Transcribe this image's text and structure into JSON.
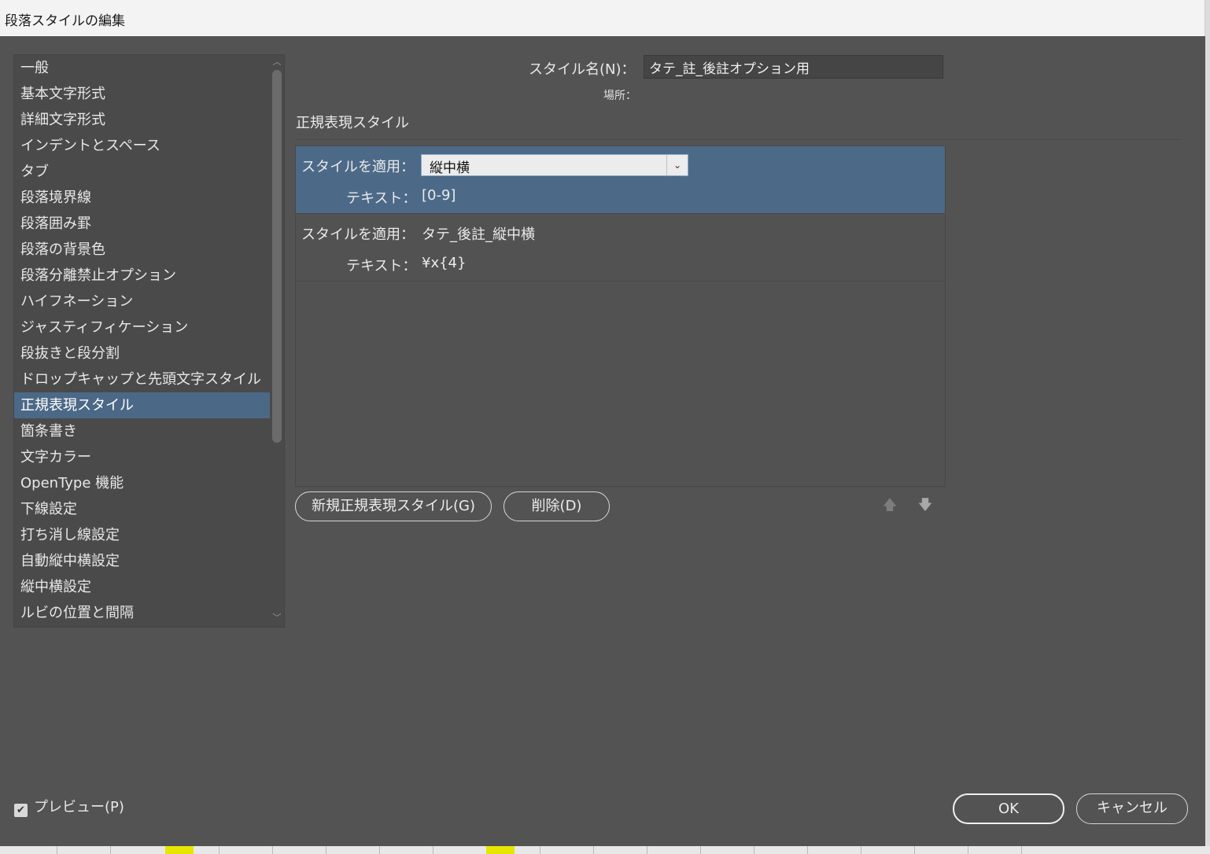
{
  "window": {
    "title": "段落スタイルの編集"
  },
  "sidebar": {
    "items": [
      {
        "label": "一般"
      },
      {
        "label": "基本文字形式"
      },
      {
        "label": "詳細文字形式"
      },
      {
        "label": "インデントとスペース"
      },
      {
        "label": "タブ"
      },
      {
        "label": "段落境界線"
      },
      {
        "label": "段落囲み罫"
      },
      {
        "label": "段落の背景色"
      },
      {
        "label": "段落分離禁止オプション"
      },
      {
        "label": "ハイフネーション"
      },
      {
        "label": "ジャスティフィケーション"
      },
      {
        "label": "段抜きと段分割"
      },
      {
        "label": "ドロップキャップと先頭文字スタイル"
      },
      {
        "label": "正規表現スタイル",
        "selected": true
      },
      {
        "label": "箇条書き"
      },
      {
        "label": "文字カラー"
      },
      {
        "label": "OpenType 機能"
      },
      {
        "label": "下線設定"
      },
      {
        "label": "打ち消し線設定"
      },
      {
        "label": "自動縦中横設定"
      },
      {
        "label": "縦中横設定"
      },
      {
        "label": "ルビの位置と間隔"
      }
    ]
  },
  "form": {
    "style_name_label": "スタイル名(N)：",
    "style_name_value": "タテ_註_後註オプション用",
    "location_label": "場所："
  },
  "section": {
    "title": "正規表現スタイル"
  },
  "rules": [
    {
      "apply_label": "スタイルを適用：",
      "style": "縦中横",
      "text_label": "テキスト：",
      "text": "[0-9]",
      "selected": true
    },
    {
      "apply_label": "スタイルを適用：",
      "style": "タテ_後註_縦中横",
      "text_label": "テキスト：",
      "text": "¥x{4}",
      "selected": false
    }
  ],
  "buttons": {
    "new_regex": "新規正規表現スタイル(G)",
    "delete": "削除(D)",
    "ok": "OK",
    "cancel": "キャンセル"
  },
  "preview": {
    "label": "プレビュー(P)",
    "checked": true
  },
  "icons": {
    "dropdown": "chevron-down-icon",
    "move_up": "arrow-up-icon",
    "move_down": "arrow-down-icon",
    "checkbox": "checkmark-icon"
  },
  "colors": {
    "dialog_bg": "#535353",
    "selection": "#4b6987",
    "title_bar": "#f3f3f3"
  }
}
